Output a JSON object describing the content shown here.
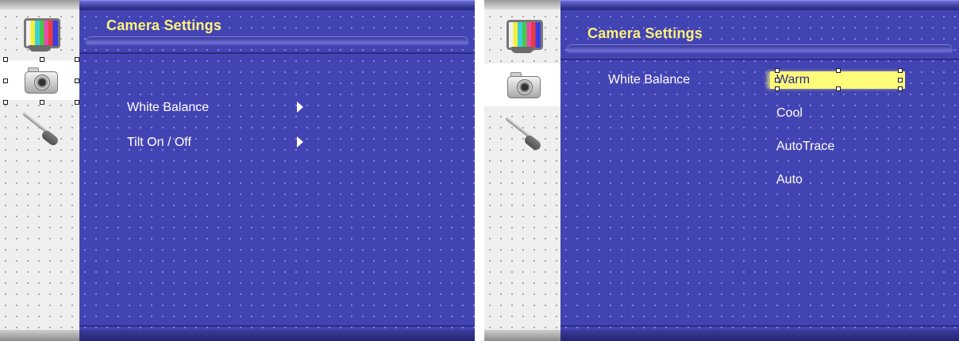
{
  "left_screen": {
    "title": "Camera Settings",
    "sidebar": [
      {
        "icon": "monitor-test-pattern-icon"
      },
      {
        "icon": "camera-icon"
      },
      {
        "icon": "tools-icon"
      }
    ],
    "menu": [
      {
        "label": "White Balance"
      },
      {
        "label": "Tilt On / Off"
      }
    ]
  },
  "right_screen": {
    "title": "Camera Settings",
    "sidebar": [
      {
        "icon": "monitor-test-pattern-icon"
      },
      {
        "icon": "camera-icon"
      },
      {
        "icon": "tools-icon"
      }
    ],
    "setting_label": "White Balance",
    "options": [
      "Warm",
      "Cool",
      "AutoTrace",
      "Auto"
    ],
    "selected_option": "Warm"
  },
  "colors": {
    "background": "#4344b4",
    "title": "#fff27a",
    "highlight": "#fffb7a",
    "sidebar": "#efefef"
  }
}
